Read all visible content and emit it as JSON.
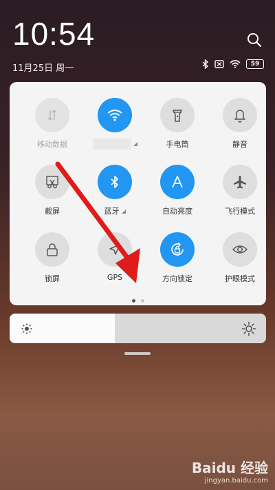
{
  "status": {
    "time": "10:54",
    "date": "11月25日 周一",
    "battery": "59"
  },
  "tiles": [
    {
      "label": "移动数据",
      "icon": "mobile-data-icon",
      "state": "disabled"
    },
    {
      "label": "",
      "icon": "wifi-icon",
      "state": "on"
    },
    {
      "label": "手电筒",
      "icon": "flashlight-icon",
      "state": "off"
    },
    {
      "label": "静音",
      "icon": "bell-icon",
      "state": "off"
    },
    {
      "label": "截屏",
      "icon": "screenshot-icon",
      "state": "off"
    },
    {
      "label": "蓝牙",
      "icon": "bluetooth-icon",
      "state": "on"
    },
    {
      "label": "自动亮度",
      "icon": "auto-brightness-icon",
      "state": "on"
    },
    {
      "label": "飞行模式",
      "icon": "airplane-icon",
      "state": "off"
    },
    {
      "label": "锁屏",
      "icon": "lock-icon",
      "state": "off"
    },
    {
      "label": "GPS",
      "icon": "gps-icon",
      "state": "off"
    },
    {
      "label": "方向锁定",
      "icon": "rotation-lock-icon",
      "state": "on"
    },
    {
      "label": "护眼模式",
      "icon": "eye-icon",
      "state": "off"
    }
  ],
  "page_indicator": {
    "pages": 2,
    "current": 1
  },
  "brightness": {
    "level": 0.41
  },
  "watermark": {
    "brand": "Baidu 经验",
    "url": "jingyan.baidu.com"
  },
  "colors": {
    "accent": "#2196f3",
    "arrow": "#e01b1b"
  }
}
